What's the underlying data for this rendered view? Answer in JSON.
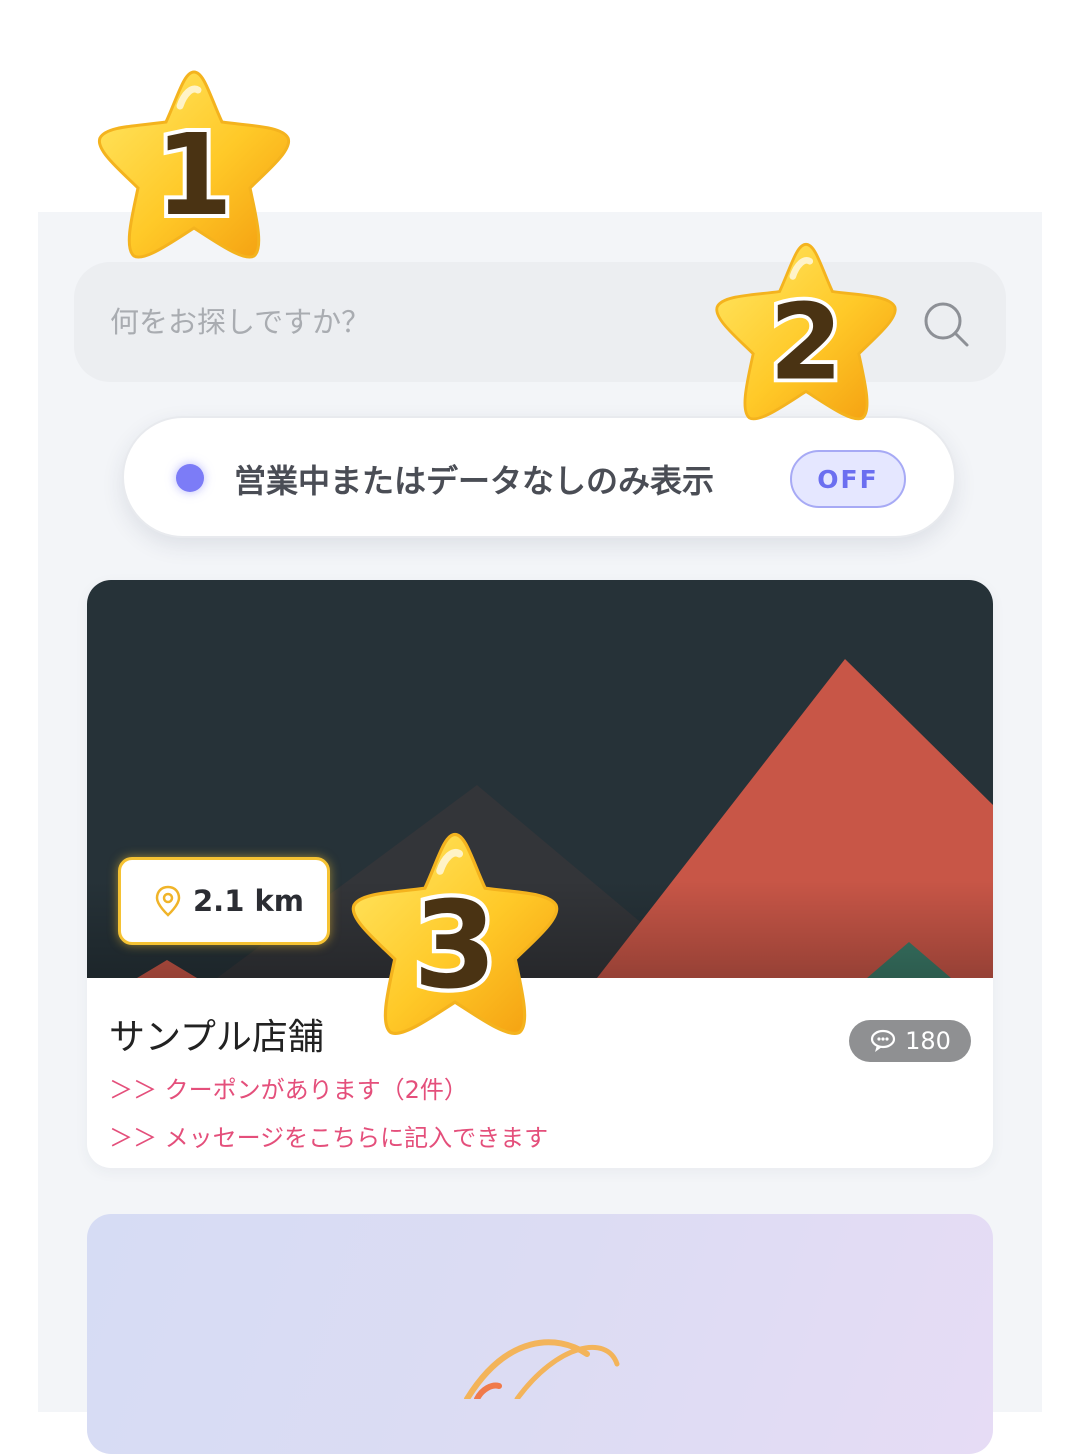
{
  "search": {
    "placeholder": "何をお探しですか？",
    "value": ""
  },
  "filter": {
    "label": "営業中またはデータなしのみ表示",
    "toggle_state": "OFF",
    "dot_color": "#7c7cf7"
  },
  "shops": [
    {
      "distance": "2.1 km",
      "name": "サンプル店舗",
      "review_count": "180",
      "links": [
        "＞＞ クーポンがあります（2件）",
        "＞＞ メッセージをこちらに記入できます"
      ]
    }
  ],
  "annotations": {
    "star_1": "1",
    "star_2": "2",
    "star_3": "3"
  },
  "colors": {
    "accent": "#6b6ff0",
    "link": "#e44f7b",
    "highlight": "#f5c233"
  },
  "icons": [
    "search-icon",
    "location-pin-icon",
    "comment-icon",
    "star-icon"
  ]
}
